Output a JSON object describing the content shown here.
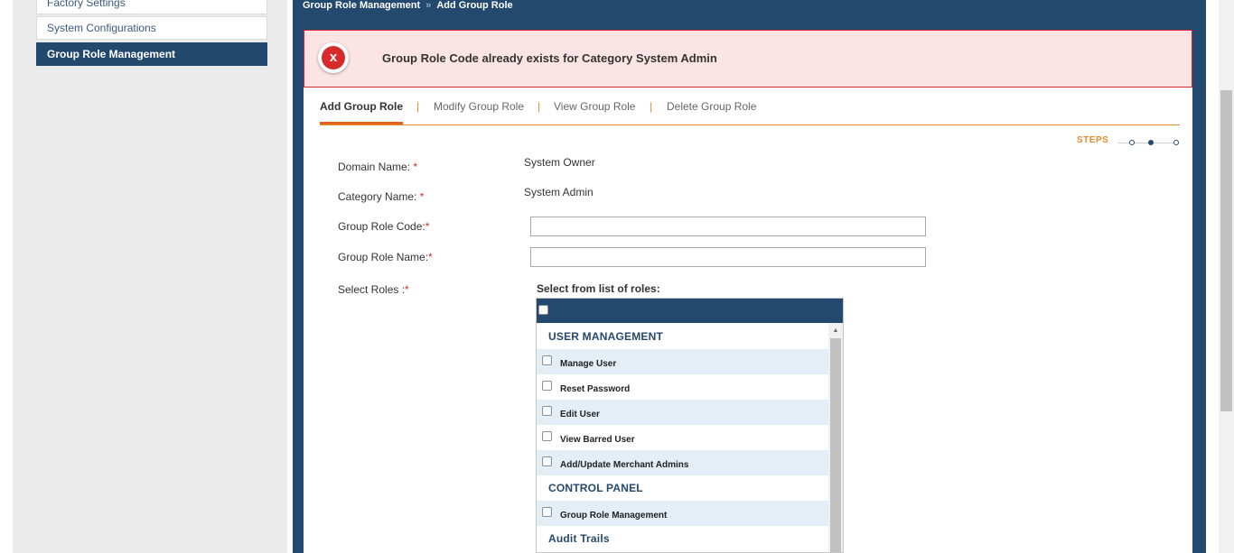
{
  "sidebar": {
    "items": [
      {
        "label": "Factory Settings"
      },
      {
        "label": "System Configurations"
      },
      {
        "label": "Group Role Management"
      }
    ]
  },
  "breadcrumb": {
    "items": [
      "Group Role Management",
      "Add Group Role"
    ],
    "separator": "»"
  },
  "error": {
    "icon": "error-x-icon",
    "icon_glyph": "x",
    "message": "Group Role Code already exists for Category System Admin"
  },
  "tabs": [
    {
      "label": "Add Group Role",
      "active": true
    },
    {
      "label": "Modify Group Role"
    },
    {
      "label": "View Group Role"
    },
    {
      "label": "Delete Group Role"
    }
  ],
  "tab_separator": "|",
  "steps": {
    "label": "STEPS",
    "total": 3,
    "current": 2
  },
  "form": {
    "domain": {
      "label": "Domain Name:",
      "value": "System Owner"
    },
    "category": {
      "label": "Category Name:",
      "value": "System Admin"
    },
    "group_role_code": {
      "label": "Group Role Code:",
      "value": ""
    },
    "group_role_name": {
      "label": "Group Role Name:",
      "value": ""
    },
    "select_roles": {
      "label": "Select Roles :"
    },
    "required_marker": "*"
  },
  "roles": {
    "title": "Select from list of roles:",
    "groups": [
      {
        "name": "USER MANAGEMENT",
        "items": [
          "Manage User",
          "Reset Password",
          "Edit User",
          "View Barred User",
          "Add/Update Merchant Admins"
        ]
      },
      {
        "name": "CONTROL PANEL",
        "items": [
          "Group Role Management"
        ]
      },
      {
        "name": "Audit Trails",
        "items": []
      }
    ]
  },
  "colors": {
    "primary": "#24496e",
    "accent": "#e98b2a",
    "error_bg": "#fce4e4",
    "error_border": "#d9272e",
    "row_alt": "#e4eef7"
  }
}
